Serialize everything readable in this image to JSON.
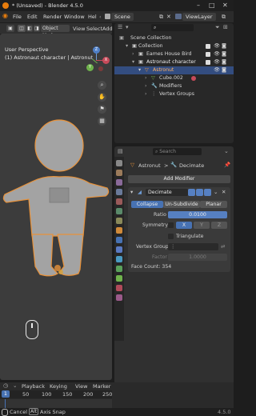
{
  "window": {
    "title": "* (Unsaved) - Blender 4.5.0"
  },
  "menu": {
    "items": [
      "File",
      "Edit",
      "Render",
      "Window",
      "Hel"
    ],
    "tab_scene": "Scene",
    "tab_viewlayer": "ViewLayer"
  },
  "viewport": {
    "mode": "Object Mode",
    "header_items": [
      "View",
      "Select",
      "Add"
    ],
    "overlay_line1": "User Perspective",
    "overlay_line2": "(1) Astronaut character | Astronut",
    "gizmo": {
      "x": "X",
      "y": "Y",
      "z": "Z"
    }
  },
  "outliner": {
    "search_placeholder": "",
    "rows": [
      {
        "label": "Scene Collection"
      },
      {
        "label": "Collection"
      },
      {
        "label": "Eames House Bird"
      },
      {
        "label": "Astronaut character"
      },
      {
        "label": "Astronut"
      },
      {
        "label": "Cube.002"
      },
      {
        "label": "Modifiers"
      },
      {
        "label": "Vertex Groups"
      }
    ]
  },
  "properties": {
    "search_placeholder": "Search",
    "breadcrumb_object": "Astronut",
    "breadcrumb_sep": ">",
    "breadcrumb_modifier": "Decimate",
    "add_modifier": "Add Modifier",
    "modifier_name": "Decimate",
    "tabs": [
      "Collapse",
      "Un-Subdivide",
      "Planar"
    ],
    "ratio_label": "Ratio",
    "ratio_value": "0.0100",
    "symmetry_label": "Symmetry",
    "sym_axes": [
      "X",
      "Y",
      "Z"
    ],
    "triangulate": "Triangulate",
    "vgroup_label": "Vertex Group",
    "factor_label": "Factor",
    "factor_value": "1.0000",
    "face_count": "Face Count: 354"
  },
  "timeline": {
    "menus": [
      "Playback",
      "Keying",
      "View",
      "Marker"
    ],
    "frame_current": "1",
    "ticks": [
      "50",
      "100",
      "150",
      "200",
      "250"
    ]
  },
  "status": {
    "cancel": "Cancel",
    "alt": "Alt",
    "axis_snap": "Axis Snap",
    "version": "4.5.0"
  },
  "colors": {
    "accent_orange": "#e87d0d",
    "selected_blue": "#334d80",
    "highlight_blue": "#4772b3",
    "modifier_blue": "#5680c2"
  }
}
